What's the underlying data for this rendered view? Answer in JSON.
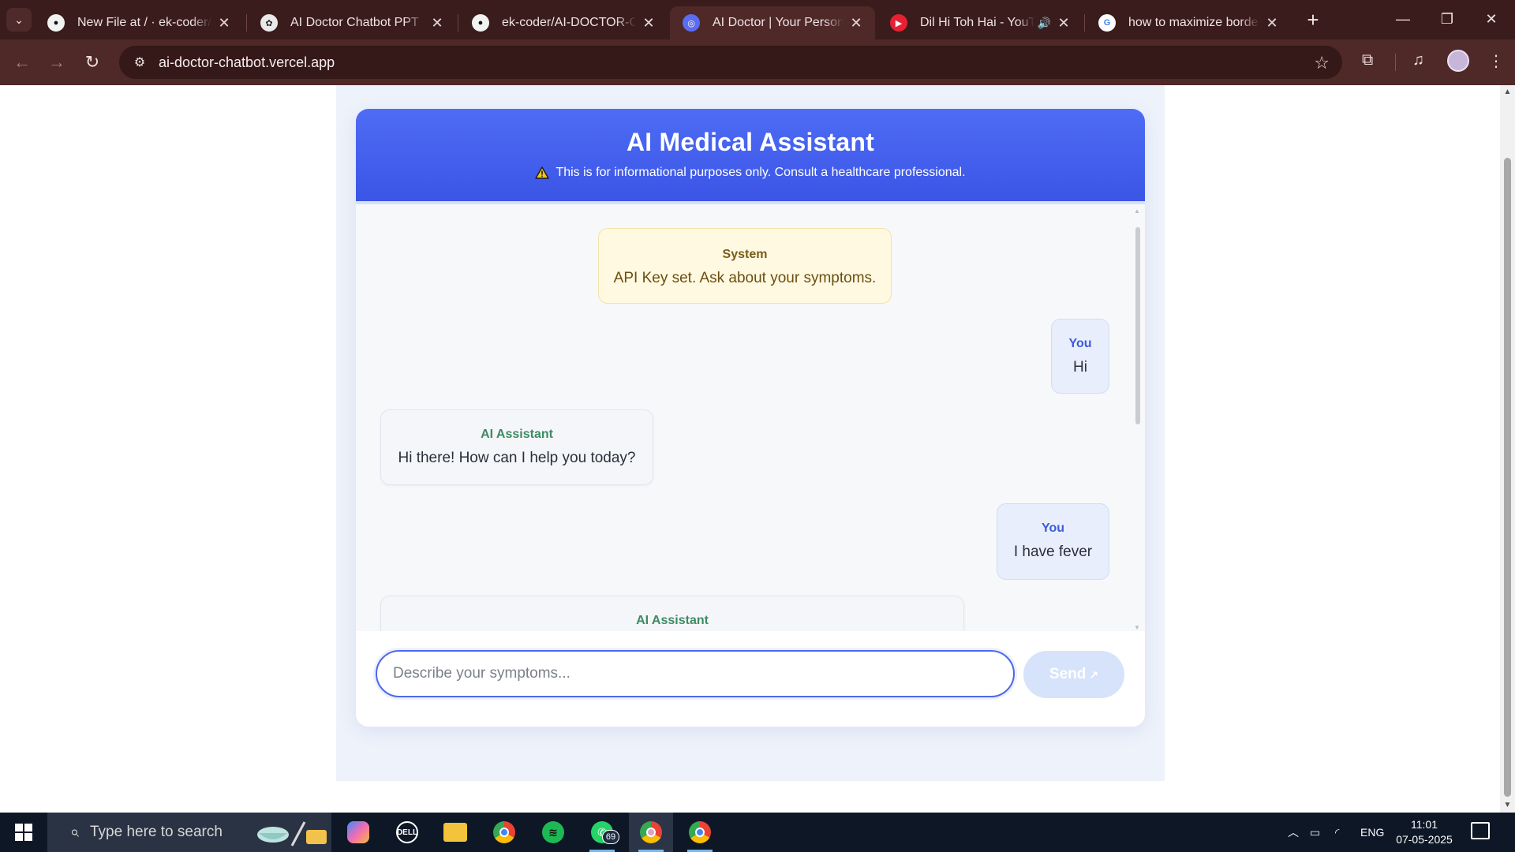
{
  "browser": {
    "tabs": [
      {
        "title": "New File at / · ek-coder/AI-DOCTOR-CHATBOT",
        "icon": "github-icon"
      },
      {
        "title": "AI Doctor Chatbot PPT",
        "icon": "openai-icon"
      },
      {
        "title": "ek-coder/AI-DOCTOR-CHATBOT",
        "icon": "github-icon"
      },
      {
        "title": "AI Doctor | Your Personal Medical Assistant",
        "icon": "app-icon",
        "active": true
      },
      {
        "title": "Dil Hi Toh Hai - YouTube",
        "icon": "youtube-icon",
        "audio": true
      },
      {
        "title": "how to maximize border m",
        "icon": "google-icon"
      }
    ],
    "url": "ai-doctor-chatbot.vercel.app",
    "theme_color": "#3a1c1c"
  },
  "app": {
    "title": "AI Medical Assistant",
    "disclaimer": "This is for informational purposes only. Consult a healthcare professional.",
    "accent": "#4a64ef",
    "messages": [
      {
        "role": "system",
        "sender": "System",
        "text": "API Key set. Ask about your symptoms."
      },
      {
        "role": "user",
        "sender": "You",
        "text": "Hi"
      },
      {
        "role": "assistant",
        "sender": "AI Assistant",
        "text": "Hi there! How can I help you today?"
      },
      {
        "role": "user",
        "sender": "You",
        "text": "I have fever"
      },
      {
        "role": "assistant",
        "sender": "AI Assistant",
        "text": ""
      }
    ],
    "input": {
      "placeholder": "Describe your symptoms...",
      "value": ""
    },
    "send_label": "Send",
    "send_icon": "↗"
  },
  "taskbar": {
    "search_placeholder": "Type here to search",
    "whatsapp_badge": "69",
    "language": "ENG",
    "time": "11:01",
    "date": "07-05-2025"
  }
}
